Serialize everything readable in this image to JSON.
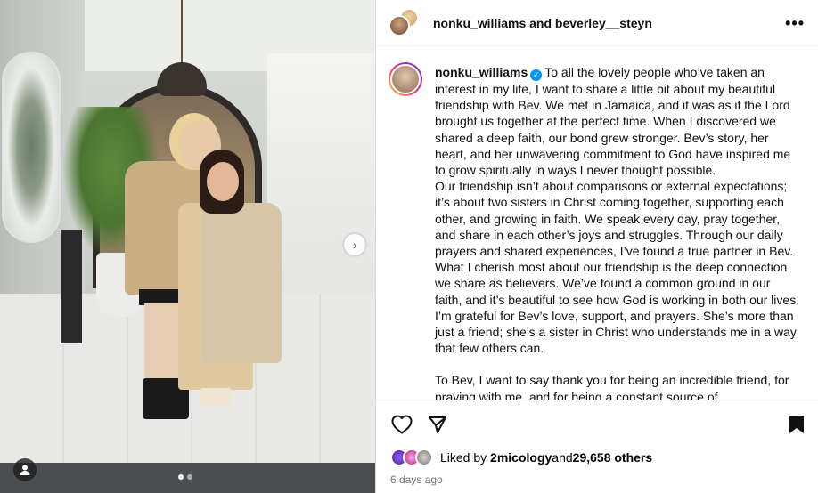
{
  "post": {
    "header_title": "nonku_williams and beverley__steyn",
    "more_label": "•••"
  },
  "caption": {
    "username": "nonku_williams",
    "p1": "To all the lovely people who’ve taken an interest in my life, I want to share a little bit about my beautiful friendship with Bev. We met in Jamaica, and it was as if the Lord brought us together at the perfect time. When I discovered we shared a deep faith, our bond grew stronger. Bev’s story, her heart, and her unwavering commitment to God have inspired me to grow spiritually in ways I never thought possible.",
    "p2": "Our friendship isn’t about comparisons or external expectations; it’s about two sisters in Christ coming together, supporting each other, and growing in faith. We speak every day, pray together, and share in each other’s joys and struggles. Through our daily prayers and shared experiences, I’ve found a true partner in Bev. What I cherish most about our friendship is the deep connection we share as believers. We’ve found a common ground in our faith, and it’s beautiful to see how God is working in both our lives. I’m grateful for Bev’s love, support, and prayers. She’s more than just a friend; she’s a sister in Christ who understands me in a way that few others can.",
    "p3": "To Bev, I want to say thank you for being an incredible friend, for praying with me, and for being a constant source of"
  },
  "likes": {
    "prefix": "Liked by ",
    "user": "2micology",
    "middle": " and ",
    "count": "29,658 others"
  },
  "timestamp": "6 days ago",
  "carousel": {
    "next_glyph": "›",
    "slide_count": 2,
    "active_index": 0
  },
  "colors": {
    "verified": "#0095f6",
    "muted": "#737373"
  }
}
